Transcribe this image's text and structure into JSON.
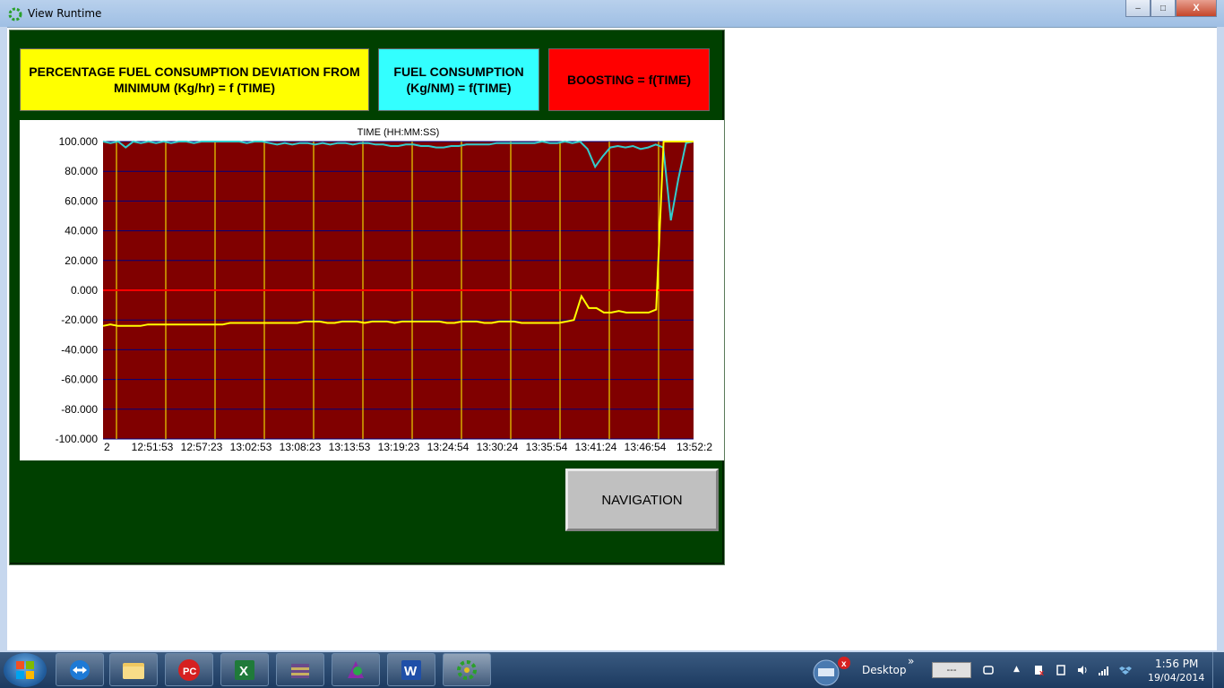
{
  "window": {
    "title": "View Runtime",
    "minimize": "–",
    "maximize": "□",
    "close": "X"
  },
  "headers": {
    "yellow": "PERCENTAGE FUEL CONSUMPTION DEVIATION FROM MINIMUM (Kg/hr) = f (TIME)",
    "cyan": "FUEL CONSUMPTION (Kg/NM) = f(TIME)",
    "red": "BOOSTING = f(TIME)"
  },
  "navigation_label": "NAVIGATION",
  "chart_data": {
    "type": "line",
    "title": "TIME (HH:MM:SS)",
    "y_ticks": [
      "100.000",
      "80.000",
      "60.000",
      "40.000",
      "20.000",
      "0.000",
      "-20.000",
      "-40.000",
      "-60.000",
      "-80.000",
      "-100.000"
    ],
    "ylim": [
      -100,
      100
    ],
    "x_tick_labels": [
      "2",
      "12:51:53",
      "12:57:23",
      "13:02:53",
      "13:08:23",
      "13:13:53",
      "13:19:23",
      "13:24:54",
      "13:30:24",
      "13:35:54",
      "13:41:24",
      "13:46:54",
      "13:52:2"
    ],
    "background_color": "#800000",
    "grid": true,
    "reference_line": {
      "y": 0,
      "color": "#ff0000"
    },
    "series": [
      {
        "color": "#33cccc",
        "values": [
          100,
          99,
          100,
          96,
          100,
          99,
          100,
          99,
          100,
          99,
          100,
          100,
          99,
          100,
          100,
          100,
          100,
          100,
          100,
          99,
          100,
          100,
          99,
          98,
          99,
          98,
          99,
          99,
          98,
          99,
          98,
          99,
          99,
          98,
          99,
          99,
          98,
          98,
          97,
          97,
          98,
          98,
          97,
          97,
          96,
          96,
          97,
          97,
          98,
          98,
          98,
          98,
          99,
          99,
          99,
          99,
          99,
          99,
          100,
          99,
          99,
          100,
          99,
          100,
          95,
          83,
          90,
          96,
          97,
          96,
          97,
          95,
          96,
          98,
          96,
          47,
          75,
          99,
          100
        ]
      },
      {
        "color": "#ffff00",
        "values": [
          -24,
          -23,
          -24,
          -24,
          -24,
          -24,
          -23,
          -23,
          -23,
          -23,
          -23,
          -23,
          -23,
          -23,
          -23,
          -23,
          -23,
          -22,
          -22,
          -22,
          -22,
          -22,
          -22,
          -22,
          -22,
          -22,
          -22,
          -21,
          -21,
          -21,
          -22,
          -22,
          -21,
          -21,
          -21,
          -22,
          -21,
          -21,
          -21,
          -22,
          -21,
          -21,
          -21,
          -21,
          -21,
          -21,
          -22,
          -22,
          -21,
          -21,
          -21,
          -22,
          -22,
          -21,
          -21,
          -21,
          -22,
          -22,
          -22,
          -22,
          -22,
          -22,
          -21,
          -20,
          -4,
          -12,
          -12,
          -15,
          -15,
          -14,
          -15,
          -15,
          -15,
          -15,
          -13,
          100,
          100,
          100,
          100,
          100
        ]
      }
    ]
  },
  "taskbar": {
    "apps": [
      "teamviewer-icon",
      "explorer-icon",
      "pdf-icon",
      "excel-icon",
      "winrar-icon",
      "app-icon",
      "word-icon",
      "runtime-icon"
    ],
    "desktop_label": "Desktop",
    "desktop_chevron": "»",
    "tray_box": "---",
    "tray_arrow": "▲",
    "time": "1:56 PM",
    "date": "19/04/2014"
  }
}
